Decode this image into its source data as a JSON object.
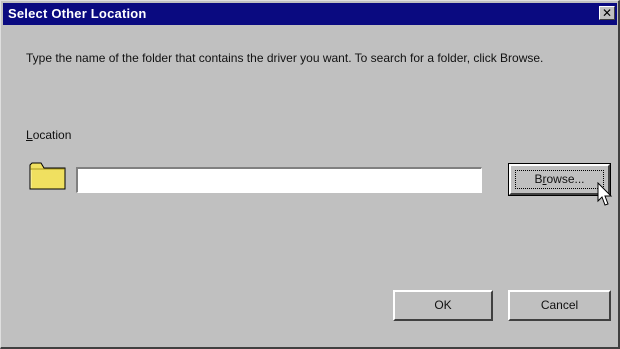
{
  "window": {
    "title": "Select Other Location",
    "close_glyph": "✕"
  },
  "instructions": "Type the name of the folder that contains the driver you want. To search for a folder, click Browse.",
  "location": {
    "label_first": "L",
    "label_rest": "ocation",
    "value": "",
    "icon": "folder-icon"
  },
  "buttons": {
    "browse_pre": "B",
    "browse_accel": "r",
    "browse_post": "owse...",
    "ok": "OK",
    "cancel": "Cancel"
  },
  "colors": {
    "titlebar": "#0a0a80",
    "face": "#c0c0c0",
    "folder": "#f0e060"
  }
}
